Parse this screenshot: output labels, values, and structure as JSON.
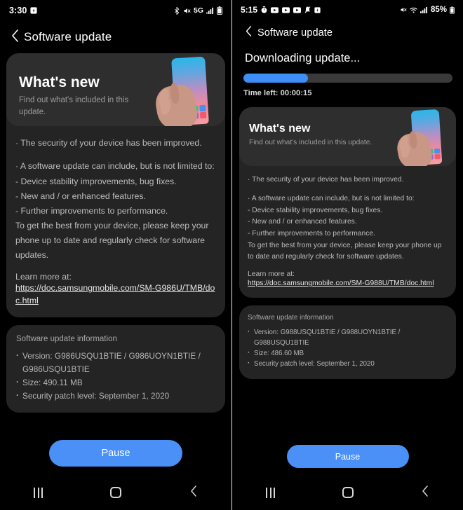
{
  "left": {
    "status_bar": {
      "time": "3:30",
      "icons": [
        "screenshot-icon",
        "bluetooth-icon",
        "mute-icon",
        "network-5g-icon",
        "signal-bars-icon",
        "battery-icon"
      ],
      "network_label": "5G"
    },
    "app_bar": {
      "back_icon": "chevron-left-icon",
      "title": "Software update"
    },
    "banner": {
      "title": "What's new",
      "subtitle": "Find out what's included in this update.",
      "illustration": "hand-holding-phone-illustration"
    },
    "body": {
      "line1": "· The security of your device has been improved.",
      "line2": "· A software update can include, but is not limited to:",
      "bullet1": " - Device stability improvements, bug fixes.",
      "bullet2": " - New and / or enhanced features.",
      "bullet3": " - Further improvements to performance.",
      "closing": "To get the best from your device, please keep your phone up to date and regularly check for software updates."
    },
    "learn_more": {
      "label": "Learn more at:",
      "url": "https://doc.samsungmobile.com/SM-G986U/TMB/doc.html"
    },
    "info": {
      "heading": "Software update information",
      "items": [
        "Version: G986USQU1BTIE / G986UOYN1BTIE / G986USQU1BTIE",
        "Size: 490.11 MB",
        "Security patch level: September 1, 2020"
      ]
    },
    "pause_button": "Pause",
    "nav_bar": {
      "recents_icon": "recents-icon",
      "home_icon": "home-icon",
      "back_icon": "back-chevron-icon"
    }
  },
  "right": {
    "status_bar": {
      "time": "5:15",
      "icons": [
        "timer-icon",
        "video-icon",
        "video-icon",
        "video-icon",
        "mute-bell-icon",
        "screenshot-icon",
        "mute-icon",
        "wifi-icon",
        "signal-bars-icon",
        "battery-icon"
      ],
      "battery_percent": "85%"
    },
    "app_bar": {
      "back_icon": "chevron-left-icon",
      "title": "Software update"
    },
    "download": {
      "title": "Downloading update...",
      "progress_percent": 31,
      "time_left": "Time left: 00:00:15",
      "bar_fill_color": "#3d8ef7",
      "bar_track_color": "#3a3a3a"
    },
    "banner": {
      "title": "What's new",
      "subtitle": "Find out what's included in this update.",
      "illustration": "hand-holding-phone-illustration"
    },
    "body": {
      "line1": "· The security of your device has been improved.",
      "line2": "· A software update can include, but is not limited to:",
      "bullet1": " - Device stability improvements, bug fixes.",
      "bullet2": " - New and / or enhanced features.",
      "bullet3": " - Further improvements to performance.",
      "closing": "To get the best from your device, please keep your phone up to date and regularly check for software updates."
    },
    "learn_more": {
      "label": "Learn more at:",
      "url": "https://doc.samsungmobile.com/SM-G988U/TMB/doc.html"
    },
    "info": {
      "heading": "Software update information",
      "items": [
        "Version: G988USQU1BTIE / G988UOYN1BTIE / G988USQU1BTIE",
        "Size: 486.60 MB",
        "Security patch level: September 1, 2020"
      ]
    },
    "pause_button": "Pause",
    "nav_bar": {
      "recents_icon": "recents-icon",
      "home_icon": "home-icon",
      "back_icon": "back-chevron-icon"
    }
  },
  "theme": {
    "accent": "#4a90f7",
    "card_bg": "#242424",
    "banner_bg": "#2e2e2e",
    "page_bg": "#000000"
  }
}
